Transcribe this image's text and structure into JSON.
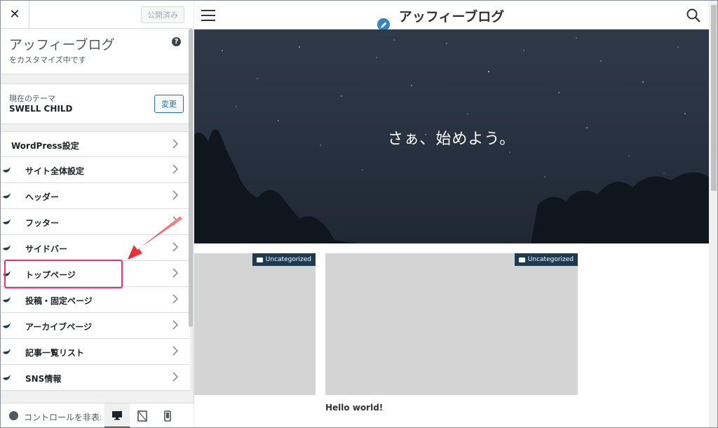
{
  "topbar": {
    "close": "✕",
    "publish": "公開済み"
  },
  "site": {
    "name": "アッフィーブログ",
    "subtitle": "をカスタマイズ中です"
  },
  "theme": {
    "label": "現在のテーマ",
    "name": "SWELL CHILD",
    "change": "変更"
  },
  "menu": [
    {
      "label": "WordPress設定",
      "icon": false
    },
    {
      "label": "サイト全体設定",
      "icon": true
    },
    {
      "label": "ヘッダー",
      "icon": true
    },
    {
      "label": "フッター",
      "icon": true
    },
    {
      "label": "サイドバー",
      "icon": true
    },
    {
      "label": "トップページ",
      "icon": true
    },
    {
      "label": "投稿・固定ページ",
      "icon": true
    },
    {
      "label": "アーカイブページ",
      "icon": true
    },
    {
      "label": "記事一覧リスト",
      "icon": true
    },
    {
      "label": "SNS情報",
      "icon": true
    }
  ],
  "footer": {
    "collapse": "コントロールを非表示"
  },
  "preview": {
    "title": "アッフィーブログ",
    "hero_text": "さぁ、始めよう。",
    "cards": [
      {
        "category": "Uncategorized"
      },
      {
        "category": "Uncategorized",
        "title": "Hello world!"
      }
    ]
  },
  "colors": {
    "accent": "#2271b1",
    "highlight": "#e8336b",
    "badge": "#1e3a4f"
  }
}
